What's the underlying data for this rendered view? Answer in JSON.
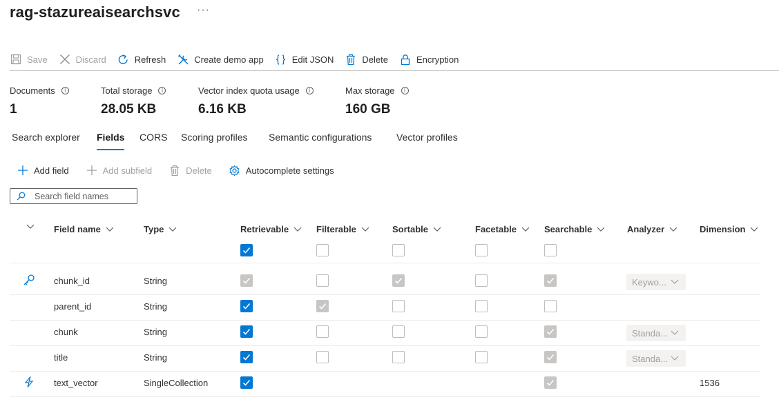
{
  "header": {
    "title": "rag-stazureaisearchsvc",
    "more": "···"
  },
  "toolbar": {
    "save": "Save",
    "discard": "Discard",
    "refresh": "Refresh",
    "create_demo": "Create demo app",
    "edit_json": "Edit JSON",
    "delete": "Delete",
    "encryption": "Encryption"
  },
  "stats": {
    "documents": {
      "label": "Documents",
      "value": "1"
    },
    "total_storage": {
      "label": "Total storage",
      "value": "28.05 KB"
    },
    "vector_quota": {
      "label": "Vector index quota usage",
      "value": "6.16 KB"
    },
    "max_storage": {
      "label": "Max storage",
      "value": "160 GB"
    }
  },
  "tabs": [
    "Search explorer",
    "Fields",
    "CORS",
    "Scoring profiles",
    "Semantic configurations",
    "Vector profiles"
  ],
  "active_tab": "Fields",
  "subtoolbar": {
    "add_field": "Add field",
    "add_subfield": "Add subfield",
    "delete": "Delete",
    "autocomplete": "Autocomplete settings"
  },
  "search": {
    "placeholder": "Search field names"
  },
  "table": {
    "columns": {
      "field_name": "Field name",
      "type": "Type",
      "retrievable": "Retrievable",
      "filterable": "Filterable",
      "sortable": "Sortable",
      "facetable": "Facetable",
      "searchable": "Searchable",
      "analyzer": "Analyzer",
      "dimensions": "Dimension"
    },
    "header_checks": {
      "retrievable": "on",
      "filterable": "off",
      "sortable": "off",
      "facetable": "off",
      "searchable": "off"
    },
    "rows": [
      {
        "icon": "key-icon",
        "name": "chunk_id",
        "type": "String",
        "retrievable": "dis",
        "filterable": "off",
        "sortable": "dis",
        "facetable": "off",
        "searchable": "dis",
        "analyzer": "Keywo...",
        "dimensions": ""
      },
      {
        "icon": "",
        "name": "parent_id",
        "type": "String",
        "retrievable": "on",
        "filterable": "dis",
        "sortable": "off",
        "facetable": "off",
        "searchable": "off",
        "analyzer": "",
        "dimensions": ""
      },
      {
        "icon": "",
        "name": "chunk",
        "type": "String",
        "retrievable": "on",
        "filterable": "off",
        "sortable": "off",
        "facetable": "off",
        "searchable": "dis",
        "analyzer": "Standa...",
        "dimensions": ""
      },
      {
        "icon": "",
        "name": "title",
        "type": "String",
        "retrievable": "on",
        "filterable": "off",
        "sortable": "off",
        "facetable": "off",
        "searchable": "dis",
        "analyzer": "Standa...",
        "dimensions": ""
      },
      {
        "icon": "lightning-icon",
        "name": "text_vector",
        "type": "SingleCollection",
        "retrievable": "on",
        "filterable": "",
        "sortable": "",
        "facetable": "",
        "searchable": "dis",
        "analyzer": "",
        "dimensions": "1536"
      }
    ]
  },
  "colors": {
    "accent": "#0078d4",
    "text": "#323130",
    "disabled": "#a19f9d"
  }
}
